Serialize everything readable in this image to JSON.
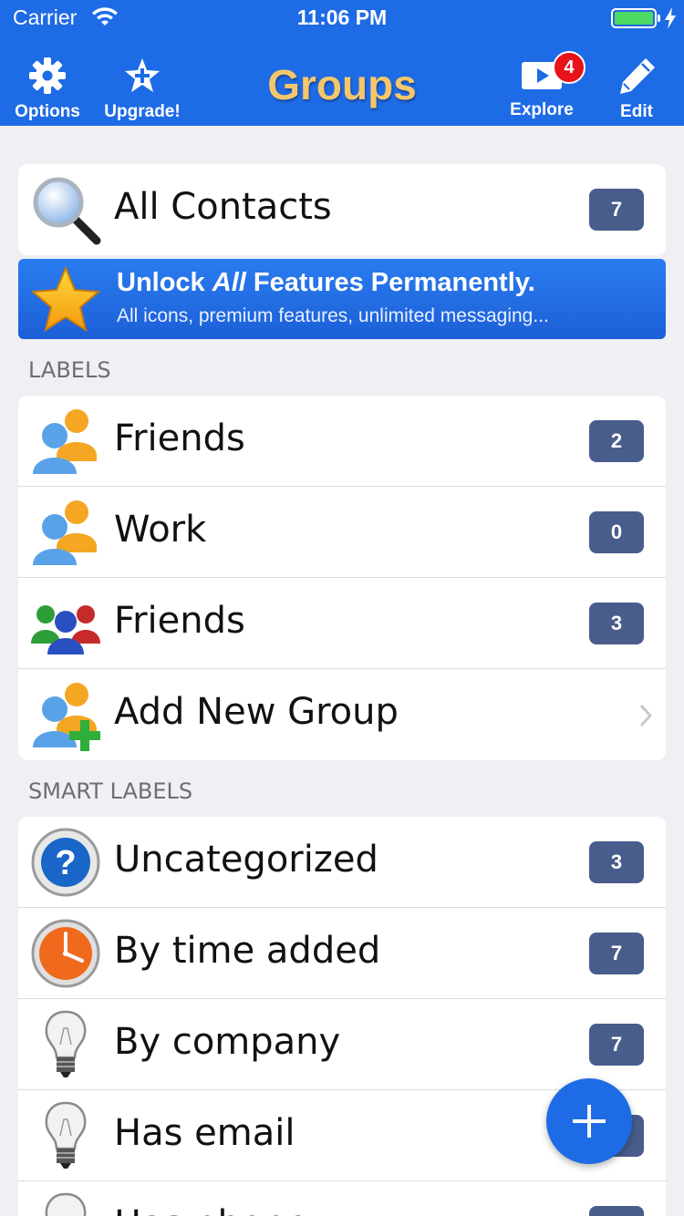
{
  "status_bar": {
    "carrier": "Carrier",
    "time": "11:06 PM"
  },
  "nav": {
    "title": "Groups",
    "options_label": "Options",
    "upgrade_label": "Upgrade!",
    "explore_label": "Explore",
    "explore_badge": "4",
    "edit_label": "Edit"
  },
  "all_contacts": {
    "label": "All Contacts",
    "count": "7"
  },
  "promo": {
    "title_prefix": "Unlock ",
    "title_emphasis": "All",
    "title_suffix": " Features Permanently.",
    "subtitle": "All icons, premium features, unlimited messaging..."
  },
  "labels_section": {
    "header": "LABELS",
    "items": [
      {
        "label": "Friends",
        "count": "2",
        "icon": "people-blue-orange-icon"
      },
      {
        "label": "Work",
        "count": "0",
        "icon": "people-blue-orange-icon"
      },
      {
        "label": "Friends",
        "count": "3",
        "icon": "people-green-blue-red-icon"
      },
      {
        "label": "Add New Group",
        "icon": "add-group-icon"
      }
    ]
  },
  "smart_labels_section": {
    "header": "SMART LABELS",
    "items": [
      {
        "label": "Uncategorized",
        "count": "3",
        "icon": "question-icon"
      },
      {
        "label": "By time added",
        "count": "7",
        "icon": "clock-icon"
      },
      {
        "label": "By company",
        "count": "7",
        "icon": "lightbulb-icon"
      },
      {
        "label": "Has email",
        "count": "",
        "icon": "lightbulb-icon"
      },
      {
        "label": "Has phone",
        "count": "",
        "icon": "lightbulb-icon"
      }
    ]
  },
  "colors": {
    "nav_bg": "#1e6be6",
    "title_gold": "#f5c66b",
    "count_badge": "#485d8b",
    "page_bg": "#efeff4"
  }
}
